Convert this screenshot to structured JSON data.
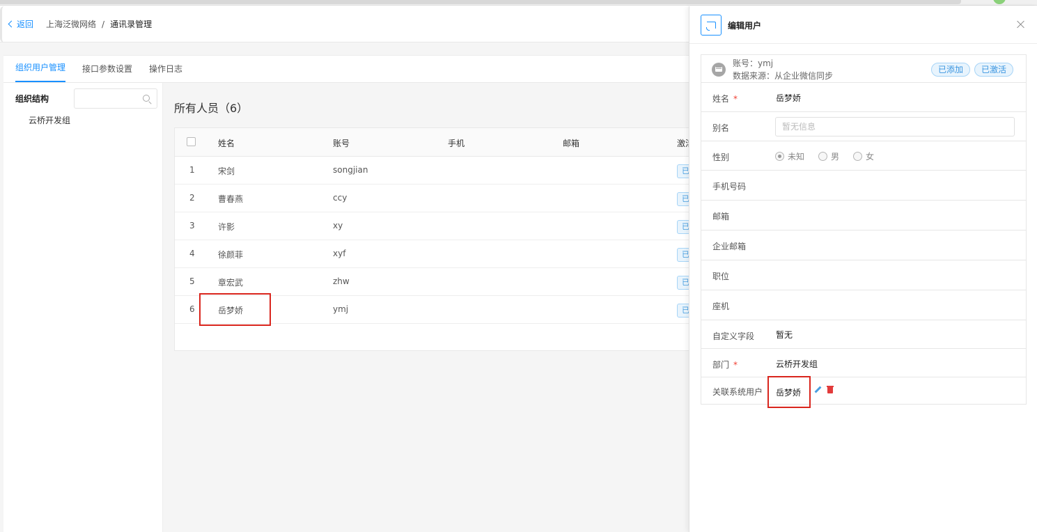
{
  "header": {
    "back_label": "返回",
    "breadcrumb": [
      "上海泛微网络",
      "通讯录管理"
    ],
    "separator": "/"
  },
  "tabs": [
    {
      "label": "组织用户管理",
      "active": true
    },
    {
      "label": "接口参数设置",
      "active": false
    },
    {
      "label": "操作日志",
      "active": false
    }
  ],
  "org": {
    "label": "组织结构",
    "search_placeholder": "",
    "nodes": [
      "云桥开发组"
    ]
  },
  "list": {
    "title": "所有人员（6）",
    "columns": [
      "姓名",
      "账号",
      "手机",
      "邮箱",
      "激活"
    ],
    "rows": [
      {
        "index": "1",
        "name": "宋剑",
        "account": "songjian",
        "status": "已"
      },
      {
        "index": "2",
        "name": "曹春燕",
        "account": "ccy",
        "status": "已"
      },
      {
        "index": "3",
        "name": "许影",
        "account": "xy",
        "status": "已"
      },
      {
        "index": "4",
        "name": "徐颜菲",
        "account": "xyf",
        "status": "已"
      },
      {
        "index": "5",
        "name": "章宏武",
        "account": "zhw",
        "status": "已"
      },
      {
        "index": "6",
        "name": "岳梦娇",
        "account": "ymj",
        "status": "已"
      }
    ]
  },
  "drawer": {
    "title": "编辑用户",
    "account_line": "账号：ymj",
    "source_line": "数据来源：从企业微信同步",
    "tags": [
      "已添加",
      "已激活"
    ],
    "fields": {
      "name_label": "姓名",
      "name_value": "岳梦娇",
      "alias_label": "别名",
      "alias_placeholder": "暂无信息",
      "gender_label": "性别",
      "gender_options": [
        "未知",
        "男",
        "女"
      ],
      "gender_selected": "未知",
      "mobile_label": "手机号码",
      "email_label": "邮箱",
      "corp_email_label": "企业邮箱",
      "position_label": "职位",
      "phone_label": "座机",
      "custom_label": "自定义字段",
      "custom_value": "暂无",
      "dept_label": "部门",
      "dept_value": "云桥开发组",
      "linked_label": "关联系统用户",
      "linked_value": "岳梦娇"
    },
    "required_mark": "*"
  },
  "colors": {
    "accent": "#1890ff",
    "highlight": "#d9251d",
    "required": "#f04134"
  }
}
